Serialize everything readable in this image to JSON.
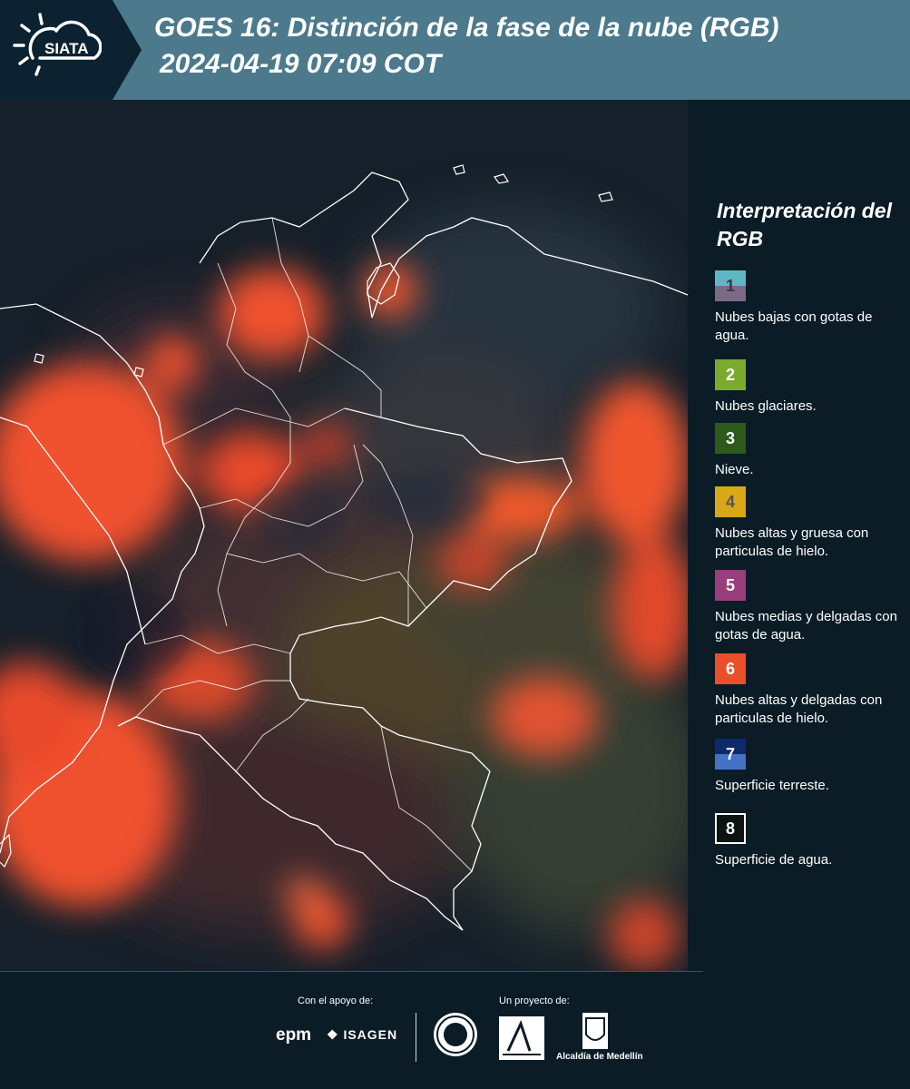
{
  "header": {
    "logo_text": "SIATA",
    "title_line1": "GOES 16: Distinción de la fase de la nube (RGB)",
    "title_line2": "2024-04-19 07:09 COT"
  },
  "legend": {
    "title": "Interpretación del RGB",
    "items": [
      {
        "number": "1",
        "label": "Nubes bajas con gotas de agua.",
        "color_top": "#5fb6c4",
        "color_bottom": "#7a6a86",
        "text_color": "#3a3a3a"
      },
      {
        "number": "2",
        "label": "Nubes glaciares.",
        "color_top": "#7bab2c",
        "color_bottom": "#7bab2c",
        "text_color": "#ffffff"
      },
      {
        "number": "3",
        "label": "Nieve.",
        "color_top": "#2d5a1a",
        "color_bottom": "#2d5a1a",
        "text_color": "#ffffff"
      },
      {
        "number": "4",
        "label": "Nubes altas y gruesa con particulas de hielo.",
        "color_top": "#d9a718",
        "color_bottom": "#d9a718",
        "text_color": "#555555"
      },
      {
        "number": "5",
        "label": "Nubes medias y delgadas con gotas de agua.",
        "color_top": "#9a3d7c",
        "color_bottom": "#9a3d7c",
        "text_color": "#ffffff"
      },
      {
        "number": "6",
        "label": "Nubes altas y delgadas con particulas de hielo.",
        "color_top": "#e94f2a",
        "color_bottom": "#e94f2a",
        "text_color": "#ffffff"
      },
      {
        "number": "7",
        "label": "Superficie terreste.",
        "color_top": "#0f2a6b",
        "color_bottom": "#4472c4",
        "text_color": "#ffffff"
      },
      {
        "number": "8",
        "label": "Superficie de agua.",
        "color_top": "#0a1410",
        "color_bottom": "#0a1410",
        "text_color": "#ffffff"
      }
    ]
  },
  "footer": {
    "support_label": "Con el apoyo de:",
    "project_label": "Un proyecto de:",
    "sponsors": [
      "epm",
      "ISAGEN"
    ],
    "partners": [
      "Área Metropolitana Valle de Aburrá",
      "Alcaldía de Medellín"
    ],
    "alcaldia_text": "Alcaldía de Medellín"
  }
}
